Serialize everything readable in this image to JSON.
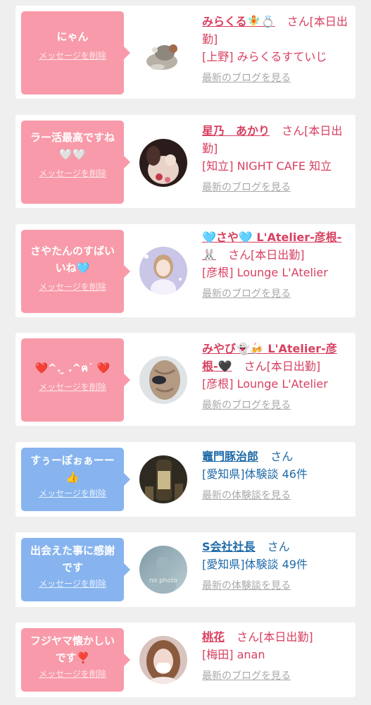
{
  "colors": {
    "background": "#efefef",
    "bubble_pink": "#f89aa9",
    "bubble_blue": "#87b4ef",
    "text_pink": "#d84060",
    "text_blue": "#1e6aa8",
    "link_gray": "#a8a8a8"
  },
  "cards": [
    {
      "message": "にゃん",
      "delete_label": "メッセージを削除",
      "name": "みらくる🧚💍",
      "suffix": "さん[本日出勤]",
      "location": "[上野] みらくるすていじ",
      "link": "最新のブログを見る",
      "avatar": "cat-photo"
    },
    {
      "message": "ラー活最高ですね🤍🤍",
      "delete_label": "メッセージを削除",
      "name": "星乃　あかり",
      "suffix": "さん[本日出勤]",
      "location": "[知立] NIGHT CAFE 知立",
      "link": "最新のブログを見る",
      "avatar": "person-photo"
    },
    {
      "message": "さやたんのすばいいね🩵",
      "delete_label": "メッセージを削除",
      "name": "🩵さや🩵 L'Atelier-彦根-🐰",
      "suffix": "さん[本日出勤]",
      "location": "[彦根] Lounge L'Atelier",
      "link": "最新のブログを見る",
      "avatar": "person-photo"
    },
    {
      "message": "❤️^. ̫ .^ฅ˙ ❤️",
      "delete_label": "メッセージを削除",
      "name": "みやび👻🍻 L'Atelier-彦根-🖤",
      "suffix": "さん[本日出勤]",
      "location": "[彦根] Lounge L'Atelier",
      "link": "最新のブログを見る",
      "avatar": "hair-photo"
    },
    {
      "message": "すぅーぽぉぁーー👍",
      "delete_label": "メッセージを削除",
      "name": "竈門豚治郎",
      "suffix": "さん",
      "location": "[愛知県]体験談 46件",
      "link": "最新の体験談を見る",
      "avatar": "bottle-photo"
    },
    {
      "message": "出会えた事に感謝です",
      "delete_label": "メッセージを削除",
      "name": "S会社社長",
      "suffix": "さん",
      "location": "[愛知県]体験談 49件",
      "link": "最新の体験談を見る",
      "avatar": "no-photo",
      "avatar_text": "no photo"
    },
    {
      "message": "フジヤマ懐かしいです❣️",
      "delete_label": "メッセージを削除",
      "name": "桃花",
      "suffix": "さん[本日出勤]",
      "location": "[梅田] anan",
      "link": "最新のブログを見る",
      "avatar": "person-photo"
    }
  ]
}
